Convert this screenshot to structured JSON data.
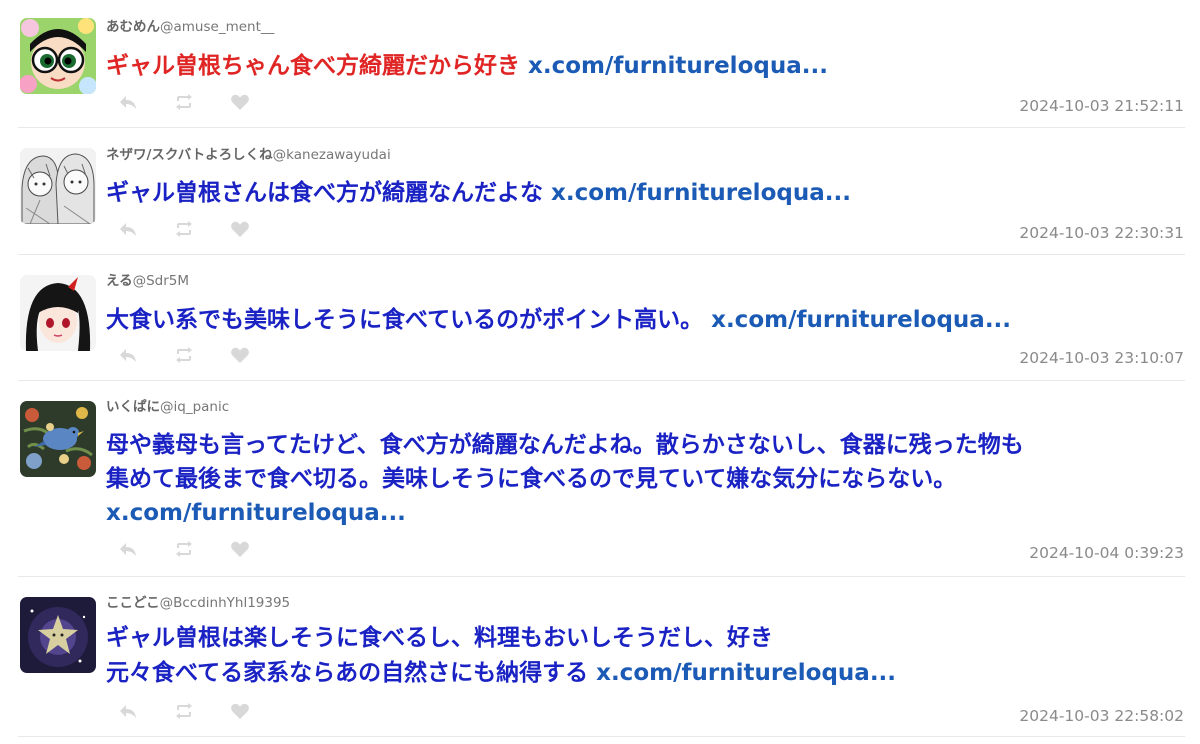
{
  "tweets": [
    {
      "name": "あむめん",
      "handle": "@amuse_ment__",
      "text": "ギャル曽根ちゃん食べ方綺麗だから好き",
      "link": "x.com/furnitureloqua...",
      "time": "2024-10-03 21:52:11"
    },
    {
      "name": "ネザワ/スクバトよろしくね",
      "handle": "@kanezawayudai",
      "text": "ギャル曽根さんは食べ方が綺麗なんだよな",
      "link": "x.com/furnitureloqua...",
      "time": "2024-10-03 22:30:31"
    },
    {
      "name": "える",
      "handle": "@Sdr5M",
      "text": "大食い系でも美味しそうに食べているのがポイント高い。",
      "link": "x.com/furnitureloqua...",
      "time": "2024-10-03 23:10:07"
    },
    {
      "name": "いくぱに",
      "handle": "@iq_panic",
      "text_line1": "母や義母も言ってたけど、食べ方が綺麗なんだよね。散らかさないし、食器に残った物も",
      "text_line2": "集めて最後まで食べ切る。美味しそうに食べるので見ていて嫌な気分にならない。",
      "link": "x.com/furnitureloqua...",
      "time": "2024-10-04 0:39:23"
    },
    {
      "name": "ここどこ",
      "handle": "@BccdinhYhl19395",
      "text_line1": "ギャル曽根は楽しそうに食べるし、料理もおいしそうだし、好き",
      "text_line2": "元々食べてる家系ならあの自然さにも納得する",
      "link": "x.com/furnitureloqua...",
      "time": "2024-10-03 22:58:02"
    }
  ],
  "icons": {
    "reply": "reply-icon",
    "retweet": "retweet-icon",
    "like": "heart-icon"
  },
  "colors": {
    "tweet_text": "#1a22c4",
    "highlight_text": "#e02525",
    "link": "#1b5bb5",
    "meta": "#8a8a8a",
    "action_icon": "#d8d8d8"
  }
}
